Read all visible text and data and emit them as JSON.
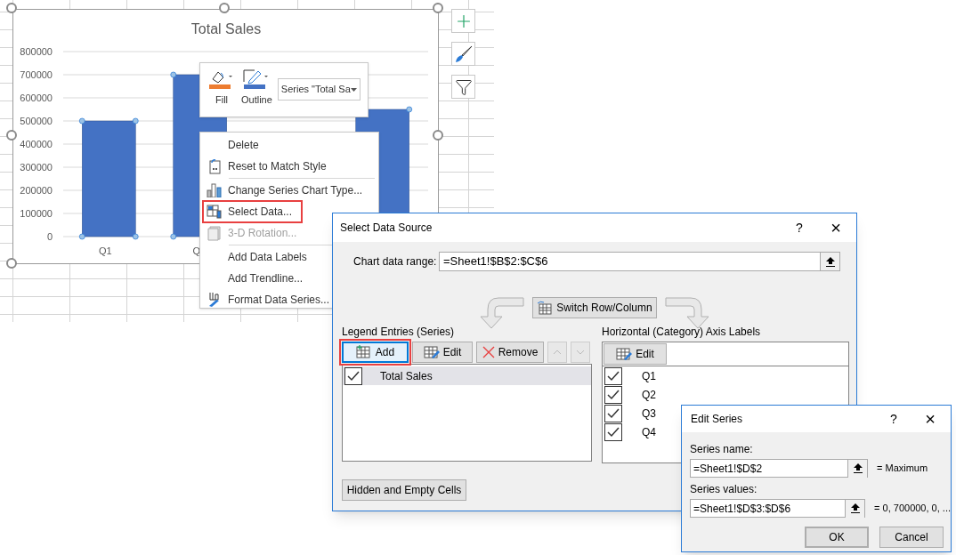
{
  "chart": {
    "chart_data": {
      "type": "bar",
      "title": "Total Sales",
      "categories": [
        "Q1",
        "Q",
        null,
        null
      ],
      "series": [
        {
          "color": "#4472c4",
          "values": [
            500000,
            700000,
            null,
            550000
          ]
        }
      ],
      "grid": true,
      "ylim": [
        0,
        800000
      ],
      "yticks": [
        0,
        100000,
        200000,
        300000,
        400000,
        500000,
        600000,
        700000,
        800000
      ]
    }
  },
  "mini_toolbar": {
    "buttons": [
      {
        "label": "Fill"
      },
      {
        "label": "Outline"
      }
    ],
    "series_dropdown": "Series \"Total Sa"
  },
  "context_menu": {
    "items": [
      {
        "kind": "item",
        "label": "Delete",
        "disabled": false,
        "highlighted": false
      },
      {
        "kind": "item",
        "label": "Reset to Match Style",
        "disabled": false,
        "highlighted": false
      },
      {
        "kind": "separator"
      },
      {
        "kind": "item",
        "label": "Change Series Chart Type...",
        "disabled": false,
        "highlighted": false
      },
      {
        "kind": "item",
        "label": "Select Data...",
        "disabled": false,
        "highlighted": true
      },
      {
        "kind": "item",
        "label": "3-D Rotation...",
        "disabled": true,
        "highlighted": false
      },
      {
        "kind": "separator"
      },
      {
        "kind": "item",
        "label": "Add Data Labels",
        "disabled": false,
        "highlighted": false
      },
      {
        "kind": "item",
        "label": "Add Trendline...",
        "disabled": false,
        "highlighted": false
      },
      {
        "kind": "item",
        "label": "Format Data Series...",
        "disabled": false,
        "highlighted": false
      }
    ]
  },
  "select_data_source": {
    "title": "Select Data Source",
    "help": "?",
    "close": "×",
    "chart_data_range": {
      "label": "Chart data range:",
      "value": "=Sheet1!$B$2:$C$6"
    },
    "switch_button": "Switch Row/Column",
    "legend": {
      "label": "Legend Entries (Series)",
      "buttons": [
        {
          "label": "Add",
          "highlighted": true
        },
        {
          "label": "Edit",
          "highlighted": false
        },
        {
          "label": "Remove",
          "highlighted": false
        }
      ],
      "rows": [
        {
          "label": "Total Sales",
          "checked": true,
          "selected": true
        }
      ]
    },
    "axis": {
      "label": "Horizontal (Category) Axis Labels",
      "edit_button": "Edit",
      "rows": [
        {
          "label": "Q1",
          "checked": true
        },
        {
          "label": "Q2",
          "checked": true
        },
        {
          "label": "Q3",
          "checked": true
        },
        {
          "label": "Q4",
          "checked": true
        }
      ]
    },
    "hidden_cells_button": "Hidden and Empty Cells"
  },
  "edit_series": {
    "title": "Edit Series",
    "help": "?",
    "close": "×",
    "fields": [
      {
        "label": "Series name:",
        "value": "=Sheet1!$D$2",
        "result": "= Maximum"
      },
      {
        "label": "Series values:",
        "value": "=Sheet1!$D$3:$D$6",
        "result": "= 0, 700000, 0, ..."
      }
    ],
    "ok": "OK",
    "cancel": "Cancel"
  }
}
